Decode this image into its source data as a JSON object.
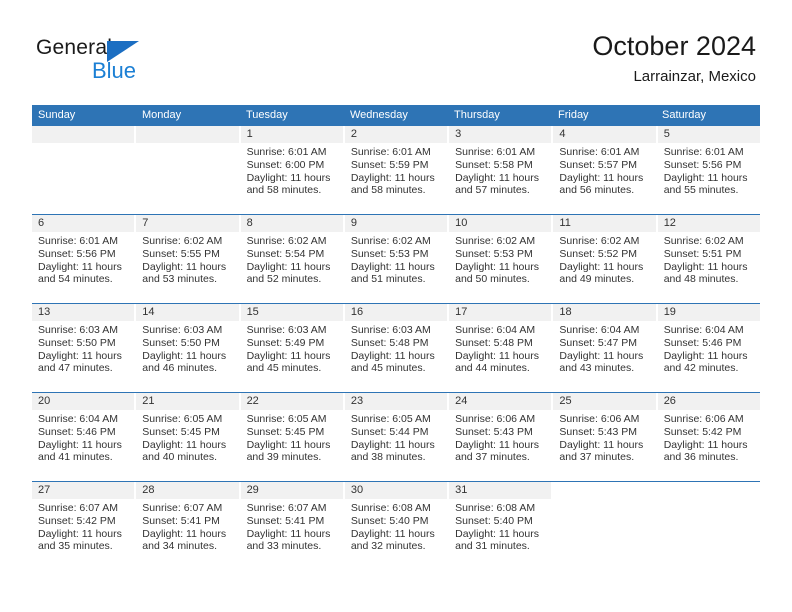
{
  "brand": {
    "name_top": "General",
    "name_bottom": "Blue",
    "triangle_color": "#1b6ec2",
    "blue_text_color": "#1b7fd4"
  },
  "header": {
    "title": "October 2024",
    "subtitle": "Larrainzar, Mexico"
  },
  "theme": {
    "header_blue": "#2e74b5",
    "daynum_band": "#f1f1f1",
    "text": "#333333"
  },
  "weekday_headers": [
    "Sunday",
    "Monday",
    "Tuesday",
    "Wednesday",
    "Thursday",
    "Friday",
    "Saturday"
  ],
  "weeks": [
    {
      "days": [
        {
          "num": "",
          "lines": []
        },
        {
          "num": "",
          "lines": []
        },
        {
          "num": "1",
          "lines": [
            "Sunrise: 6:01 AM",
            "Sunset: 6:00 PM",
            "Daylight: 11 hours",
            "and 58 minutes."
          ]
        },
        {
          "num": "2",
          "lines": [
            "Sunrise: 6:01 AM",
            "Sunset: 5:59 PM",
            "Daylight: 11 hours",
            "and 58 minutes."
          ]
        },
        {
          "num": "3",
          "lines": [
            "Sunrise: 6:01 AM",
            "Sunset: 5:58 PM",
            "Daylight: 11 hours",
            "and 57 minutes."
          ]
        },
        {
          "num": "4",
          "lines": [
            "Sunrise: 6:01 AM",
            "Sunset: 5:57 PM",
            "Daylight: 11 hours",
            "and 56 minutes."
          ]
        },
        {
          "num": "5",
          "lines": [
            "Sunrise: 6:01 AM",
            "Sunset: 5:56 PM",
            "Daylight: 11 hours",
            "and 55 minutes."
          ]
        }
      ]
    },
    {
      "days": [
        {
          "num": "6",
          "lines": [
            "Sunrise: 6:01 AM",
            "Sunset: 5:56 PM",
            "Daylight: 11 hours",
            "and 54 minutes."
          ]
        },
        {
          "num": "7",
          "lines": [
            "Sunrise: 6:02 AM",
            "Sunset: 5:55 PM",
            "Daylight: 11 hours",
            "and 53 minutes."
          ]
        },
        {
          "num": "8",
          "lines": [
            "Sunrise: 6:02 AM",
            "Sunset: 5:54 PM",
            "Daylight: 11 hours",
            "and 52 minutes."
          ]
        },
        {
          "num": "9",
          "lines": [
            "Sunrise: 6:02 AM",
            "Sunset: 5:53 PM",
            "Daylight: 11 hours",
            "and 51 minutes."
          ]
        },
        {
          "num": "10",
          "lines": [
            "Sunrise: 6:02 AM",
            "Sunset: 5:53 PM",
            "Daylight: 11 hours",
            "and 50 minutes."
          ]
        },
        {
          "num": "11",
          "lines": [
            "Sunrise: 6:02 AM",
            "Sunset: 5:52 PM",
            "Daylight: 11 hours",
            "and 49 minutes."
          ]
        },
        {
          "num": "12",
          "lines": [
            "Sunrise: 6:02 AM",
            "Sunset: 5:51 PM",
            "Daylight: 11 hours",
            "and 48 minutes."
          ]
        }
      ]
    },
    {
      "days": [
        {
          "num": "13",
          "lines": [
            "Sunrise: 6:03 AM",
            "Sunset: 5:50 PM",
            "Daylight: 11 hours",
            "and 47 minutes."
          ]
        },
        {
          "num": "14",
          "lines": [
            "Sunrise: 6:03 AM",
            "Sunset: 5:50 PM",
            "Daylight: 11 hours",
            "and 46 minutes."
          ]
        },
        {
          "num": "15",
          "lines": [
            "Sunrise: 6:03 AM",
            "Sunset: 5:49 PM",
            "Daylight: 11 hours",
            "and 45 minutes."
          ]
        },
        {
          "num": "16",
          "lines": [
            "Sunrise: 6:03 AM",
            "Sunset: 5:48 PM",
            "Daylight: 11 hours",
            "and 45 minutes."
          ]
        },
        {
          "num": "17",
          "lines": [
            "Sunrise: 6:04 AM",
            "Sunset: 5:48 PM",
            "Daylight: 11 hours",
            "and 44 minutes."
          ]
        },
        {
          "num": "18",
          "lines": [
            "Sunrise: 6:04 AM",
            "Sunset: 5:47 PM",
            "Daylight: 11 hours",
            "and 43 minutes."
          ]
        },
        {
          "num": "19",
          "lines": [
            "Sunrise: 6:04 AM",
            "Sunset: 5:46 PM",
            "Daylight: 11 hours",
            "and 42 minutes."
          ]
        }
      ]
    },
    {
      "days": [
        {
          "num": "20",
          "lines": [
            "Sunrise: 6:04 AM",
            "Sunset: 5:46 PM",
            "Daylight: 11 hours",
            "and 41 minutes."
          ]
        },
        {
          "num": "21",
          "lines": [
            "Sunrise: 6:05 AM",
            "Sunset: 5:45 PM",
            "Daylight: 11 hours",
            "and 40 minutes."
          ]
        },
        {
          "num": "22",
          "lines": [
            "Sunrise: 6:05 AM",
            "Sunset: 5:45 PM",
            "Daylight: 11 hours",
            "and 39 minutes."
          ]
        },
        {
          "num": "23",
          "lines": [
            "Sunrise: 6:05 AM",
            "Sunset: 5:44 PM",
            "Daylight: 11 hours",
            "and 38 minutes."
          ]
        },
        {
          "num": "24",
          "lines": [
            "Sunrise: 6:06 AM",
            "Sunset: 5:43 PM",
            "Daylight: 11 hours",
            "and 37 minutes."
          ]
        },
        {
          "num": "25",
          "lines": [
            "Sunrise: 6:06 AM",
            "Sunset: 5:43 PM",
            "Daylight: 11 hours",
            "and 37 minutes."
          ]
        },
        {
          "num": "26",
          "lines": [
            "Sunrise: 6:06 AM",
            "Sunset: 5:42 PM",
            "Daylight: 11 hours",
            "and 36 minutes."
          ]
        }
      ]
    },
    {
      "days": [
        {
          "num": "27",
          "lines": [
            "Sunrise: 6:07 AM",
            "Sunset: 5:42 PM",
            "Daylight: 11 hours",
            "and 35 minutes."
          ]
        },
        {
          "num": "28",
          "lines": [
            "Sunrise: 6:07 AM",
            "Sunset: 5:41 PM",
            "Daylight: 11 hours",
            "and 34 minutes."
          ]
        },
        {
          "num": "29",
          "lines": [
            "Sunrise: 6:07 AM",
            "Sunset: 5:41 PM",
            "Daylight: 11 hours",
            "and 33 minutes."
          ]
        },
        {
          "num": "30",
          "lines": [
            "Sunrise: 6:08 AM",
            "Sunset: 5:40 PM",
            "Daylight: 11 hours",
            "and 32 minutes."
          ]
        },
        {
          "num": "31",
          "lines": [
            "Sunrise: 6:08 AM",
            "Sunset: 5:40 PM",
            "Daylight: 11 hours",
            "and 31 minutes."
          ]
        },
        {
          "num": "",
          "lines": []
        },
        {
          "num": "",
          "lines": []
        }
      ]
    }
  ]
}
